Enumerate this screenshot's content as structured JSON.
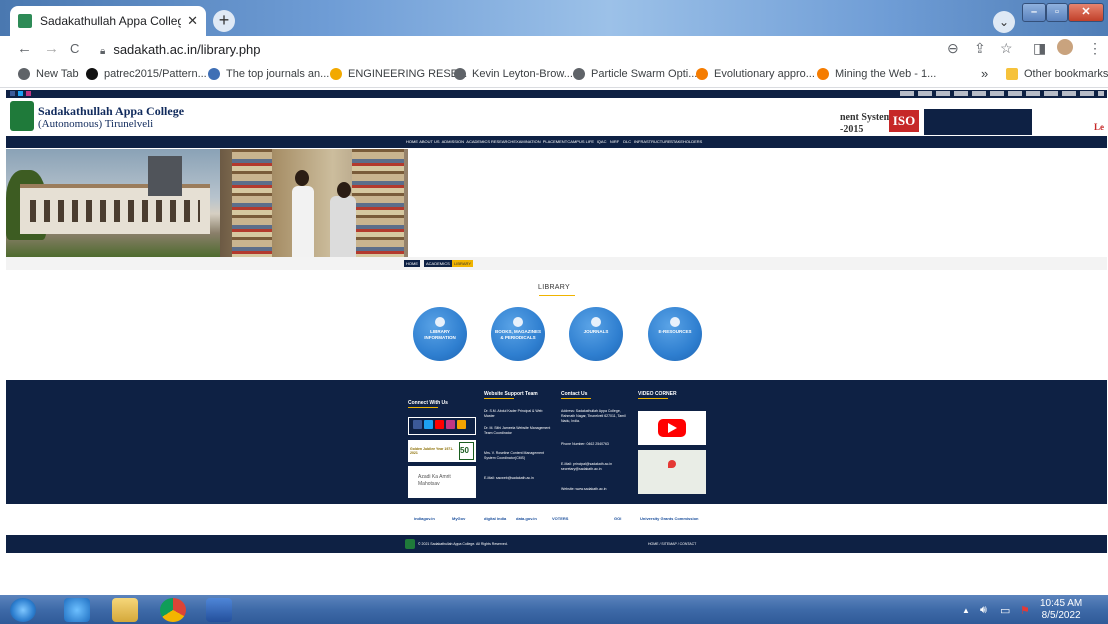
{
  "browser": {
    "tab_title": "Sadakathullah Appa College, Pal...",
    "tab_close": "✕",
    "new_tab": "+",
    "dropdown": "⌄",
    "window_min": "–",
    "window_max": "▫",
    "window_close": "✕",
    "back": "←",
    "forward": "→",
    "reload": "C",
    "url": "sadakath.ac.in/library.php",
    "zoom_icon": "⊖",
    "share_icon": "⇪",
    "star_icon": "☆",
    "sidepanel_icon": "◨",
    "menu_icon": "⋮"
  },
  "bookmarks": {
    "items": [
      {
        "label": "New Tab",
        "icon": "globe-icon",
        "color": "#5f6368"
      },
      {
        "label": "patrec2015/Pattern...",
        "icon": "github-icon",
        "color": "#111111"
      },
      {
        "label": "The top journals an...",
        "icon": "journal-icon",
        "color": "#3f6fb5"
      },
      {
        "label": "ENGINEERING RESE...",
        "icon": "triangle-icon",
        "color": "#f2a900"
      },
      {
        "label": "Kevin Leyton-Brow...",
        "icon": "globe-icon",
        "color": "#5f6368"
      },
      {
        "label": "Particle Swarm Opti...",
        "icon": "globe-icon",
        "color": "#5f6368"
      },
      {
        "label": "Evolutionary appro...",
        "icon": "elsevier-icon",
        "color": "#f57c00"
      },
      {
        "label": "Mining the Web - 1...",
        "icon": "elsevier-icon",
        "color": "#f57c00"
      }
    ],
    "more": "»",
    "other": "Other bookmarks"
  },
  "site": {
    "college_name": "Sadakathullah Appa College",
    "college_sub": "(Autonomous) Tirunelveli",
    "iso_text_1": "nent System",
    "iso_text_2": "-2015",
    "iso_badge": "ISO",
    "red_letter": "Le",
    "nav": [
      "HOME",
      "ABOUT US",
      "ADMISSION",
      "ACADEMICS",
      "RESEARCH",
      "EXAMINATION",
      "PLACEMENT",
      "CAMPUS LIFE",
      "IQAC",
      "NIRF",
      "DLC",
      "INFRASTRUCTURE",
      "STAKEHOLDERS"
    ],
    "breadcrumb": [
      "HOME",
      "ACADEMICS",
      "LIBRARY"
    ],
    "page_title": "LIBRARY",
    "circles": [
      {
        "label": "LIBRARY INFORMATION"
      },
      {
        "label": "BOOKS, MAGAZINES & PERIODICALS"
      },
      {
        "label": "JOURNALS"
      },
      {
        "label": "E-RESOURCES"
      }
    ]
  },
  "footer": {
    "connect_heading": "Connect With Us",
    "support_heading": "Website Support Team",
    "contact_heading": "Contact Us",
    "video_heading": "VIDEO CORNER",
    "golden": "Golden Jubilee Year 1971-2021",
    "azadi": "Azadi Ka Amrit Mahotsav",
    "support": [
      "Dr. S.M. Abdul Kader Principal & Web Master",
      "Dr. M. Sithi Jameela Website Management Team Coordinator",
      "Mrs. V. Roseline Content Management System Coordinator(CMS)",
      "E-Mail: sacweb@sadakath.ac.in"
    ],
    "contact": [
      "Address: Sadakathullah Appa College, Rahmath Nagar, Tirunelveli 627011, Tamil Nadu, India.",
      "Phone Number: 0462 2540763",
      "E-Mail: principal@sadakath.ac.in secretary@sadakath.ac.in",
      "Website: www.sadakath.ac.in"
    ],
    "sponsors": [
      "indiagov.in",
      "MyGov",
      "digital india",
      "data.gov.in",
      "VOTERS",
      "GOI",
      "University Grants Commission"
    ],
    "copyright": "© 2021 Sadakathullah Appa College. All Rights Reserved.",
    "links": "HOME / SITEMAP / CONTACT"
  },
  "taskbar": {
    "time": "10:45 AM",
    "date": "8/5/2022"
  }
}
